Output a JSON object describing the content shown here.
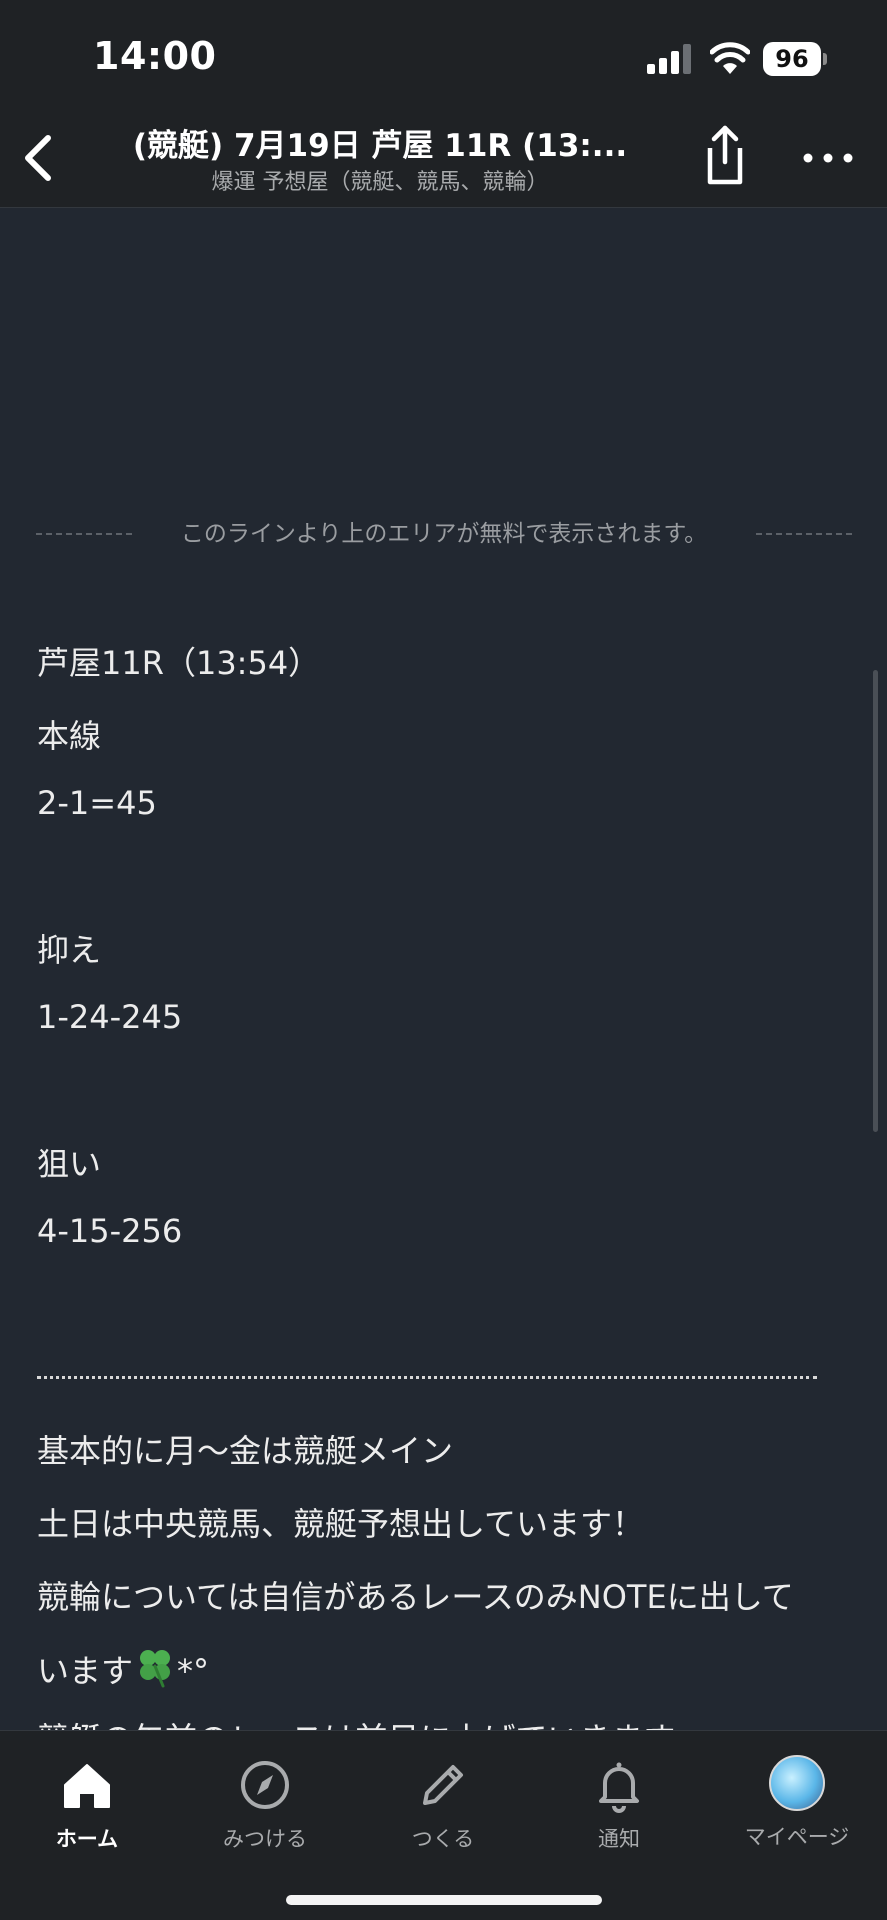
{
  "status_bar": {
    "time": "14:00",
    "battery": "96"
  },
  "nav": {
    "title": "(競艇) 7月19日 芦屋 11R (13:...",
    "subtitle": "爆運 予想屋（競艇、競馬、競輪）"
  },
  "paywall": {
    "text": "このラインより上のエリアが無料で表示されます。"
  },
  "article": {
    "race": "芦屋11R（13:54）",
    "main_label": "本線",
    "main_value": "2-1=45",
    "hold_label": "抑え",
    "hold_value": "1-24-245",
    "target_label": "狙い",
    "target_value": "4-15-256",
    "note_1": "基本的に月〜金は競艇メイン",
    "note_2": "土日は中央競馬、競艇予想出しています！",
    "note_3": "競輪については自信があるレースのみNOTEに出して",
    "note_4": "います",
    "note_4_suffix": "*°",
    "note_5": "競艇の午前のレースは前日に上げていきます"
  },
  "tabs": [
    {
      "label": "ホーム",
      "icon": "home-icon"
    },
    {
      "label": "みつける",
      "icon": "compass-icon"
    },
    {
      "label": "つくる",
      "icon": "pencil-icon"
    },
    {
      "label": "通知",
      "icon": "bell-icon"
    },
    {
      "label": "マイページ",
      "icon": "avatar"
    }
  ]
}
